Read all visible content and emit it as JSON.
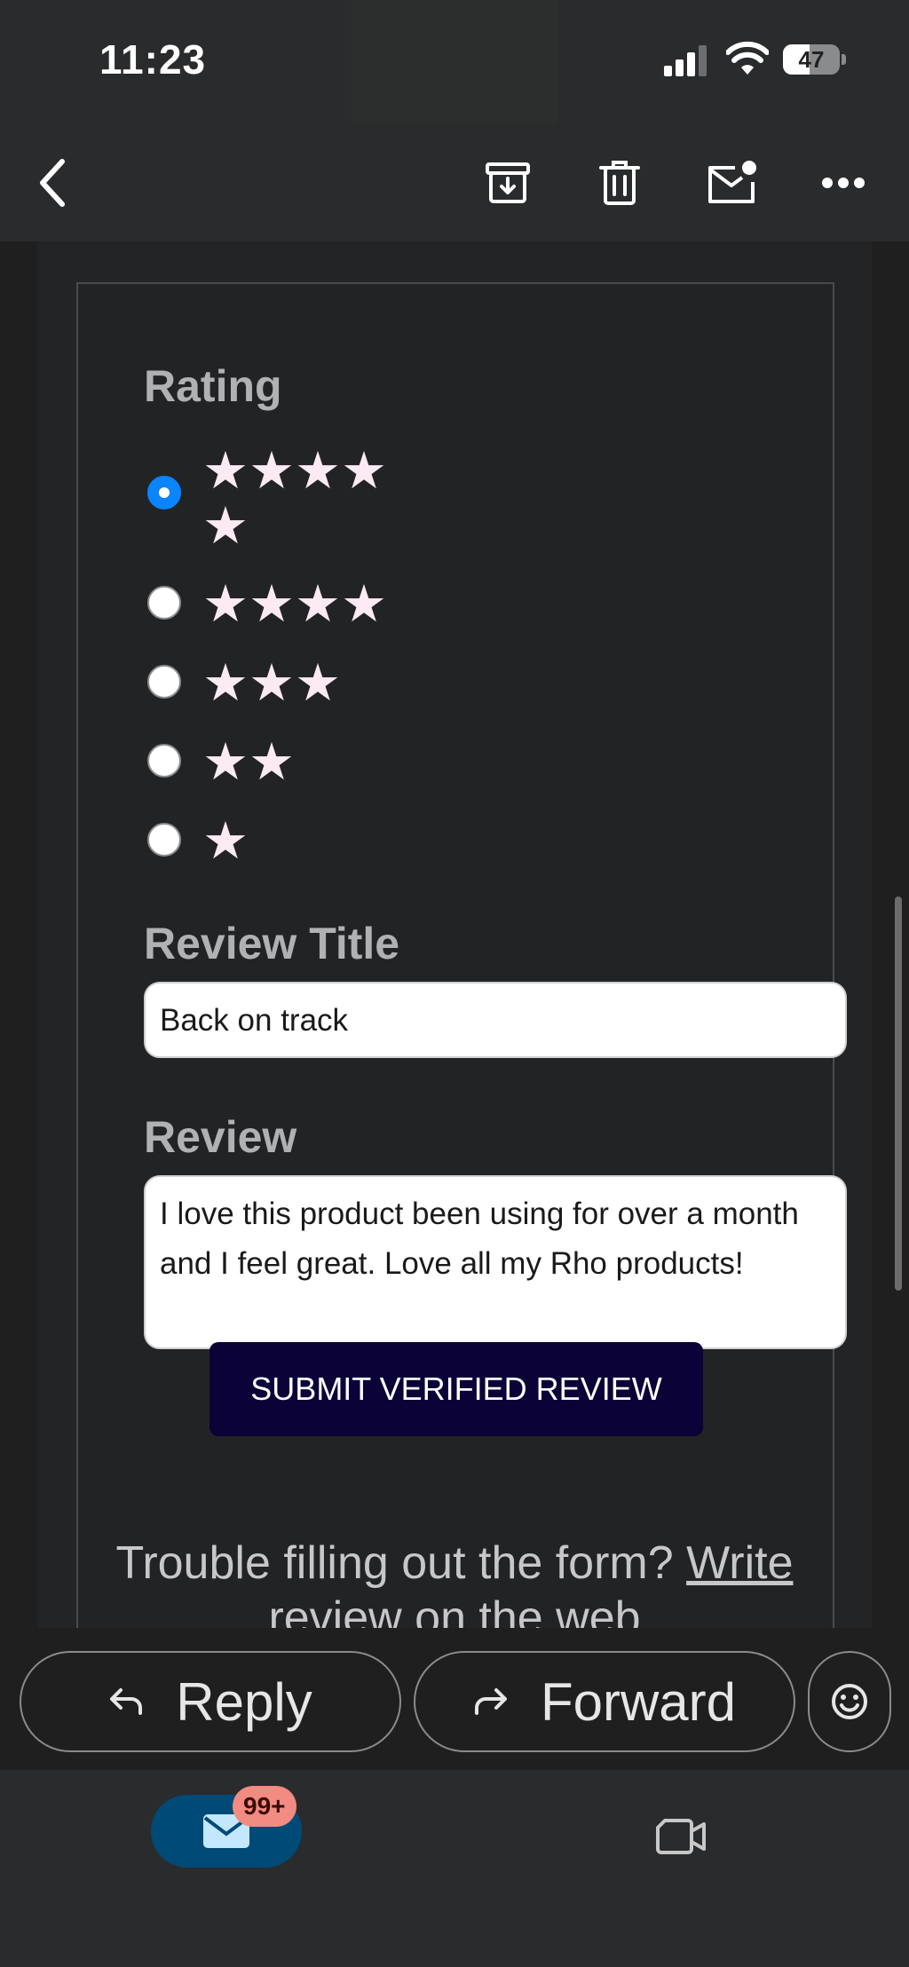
{
  "status_bar": {
    "time": "11:23",
    "battery_percent": "47",
    "battery_level": 0.47
  },
  "toolbar": {
    "back_icon": "chevron-left-icon",
    "archive_icon": "archive-icon",
    "delete_icon": "trash-icon",
    "mark_unread_icon": "mail-unread-icon",
    "more_icon": "more-horizontal-icon"
  },
  "form": {
    "rating_label": "Rating",
    "rating_options": [
      {
        "stars_line1": "★★★★",
        "stars_line2": "★",
        "selected": true
      },
      {
        "stars_line1": "★★★★",
        "selected": false
      },
      {
        "stars_line1": "★★★",
        "selected": false
      },
      {
        "stars_line1": "★★",
        "selected": false
      },
      {
        "stars_line1": "★",
        "selected": false
      }
    ],
    "review_title_label": "Review Title",
    "review_title_value": "Back on track",
    "review_label": "Review",
    "review_value": "I love this product been using for over a month and I feel great. Love all my Rho products!",
    "submit_label": "SUBMIT VERIFIED REVIEW",
    "trouble_text": "Trouble filling out the form? ",
    "trouble_link_part1": "Write",
    "trouble_link_part2": "review on the web"
  },
  "actions": {
    "reply_label": "Reply",
    "forward_label": "Forward"
  },
  "bottom_nav": {
    "mail_badge": "99+"
  },
  "colors": {
    "accent": "#0a84ff",
    "submit_bg": "#0b0237",
    "badge": "#f28b82",
    "mail_tab": "#004a77"
  }
}
